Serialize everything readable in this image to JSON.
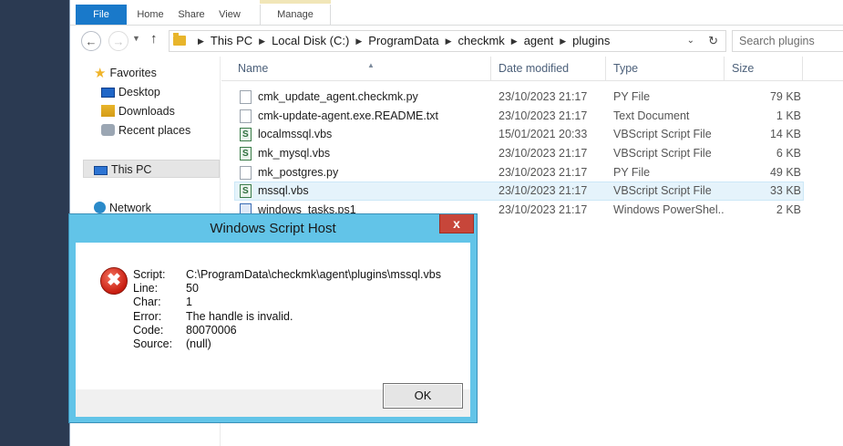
{
  "ribbon": {
    "tabs": [
      "File",
      "Home",
      "Share",
      "View",
      "Manage"
    ]
  },
  "address": {
    "crumbs": [
      "This PC",
      "Local Disk (C:)",
      "ProgramData",
      "checkmk",
      "agent",
      "plugins"
    ],
    "search_placeholder": "Search plugins"
  },
  "nav": {
    "favorites": "Favorites",
    "desktop": "Desktop",
    "downloads": "Downloads",
    "recent": "Recent places",
    "this_pc": "This PC",
    "network": "Network"
  },
  "columns": {
    "name": "Name",
    "date": "Date modified",
    "type": "Type",
    "size": "Size"
  },
  "files": [
    {
      "name": "cmk_update_agent.checkmk.py",
      "date": "23/10/2023 21:17",
      "type": "PY File",
      "size": "79 KB",
      "icon": "file-icon"
    },
    {
      "name": "cmk-update-agent.exe.README.txt",
      "date": "23/10/2023 21:17",
      "type": "Text Document",
      "size": "1 KB",
      "icon": "file-icon"
    },
    {
      "name": "localmssql.vbs",
      "date": "15/01/2021 20:33",
      "type": "VBScript Script File",
      "size": "14 KB",
      "icon": "vbscript-icon"
    },
    {
      "name": "mk_mysql.vbs",
      "date": "23/10/2023 21:17",
      "type": "VBScript Script File",
      "size": "6 KB",
      "icon": "vbscript-icon"
    },
    {
      "name": "mk_postgres.py",
      "date": "23/10/2023 21:17",
      "type": "PY File",
      "size": "49 KB",
      "icon": "file-icon"
    },
    {
      "name": "mssql.vbs",
      "date": "23/10/2023 21:17",
      "type": "VBScript Script File",
      "size": "33 KB",
      "icon": "vbscript-icon"
    },
    {
      "name": "windows_tasks.ps1",
      "date": "23/10/2023 21:17",
      "type": "Windows PowerShel...",
      "size": "2 KB",
      "icon": "powershell-icon"
    }
  ],
  "dialog": {
    "title": "Windows Script Host",
    "close_label": "x",
    "labels": {
      "script": "Script:",
      "line": "Line:",
      "char": "Char:",
      "error": "Error:",
      "code": "Code:",
      "source": "Source:"
    },
    "values": {
      "script": "C:\\ProgramData\\checkmk\\agent\\plugins\\mssql.vbs",
      "line": "50",
      "char": "1",
      "error": "The handle is invalid.",
      "code": "80070006",
      "source": "(null)"
    },
    "ok_label": "OK"
  },
  "colors": {
    "file_tab": "#1979ca",
    "dialog_frame": "#62c4e8",
    "close_button": "#c7463a",
    "selection": "#e5f3fb"
  }
}
